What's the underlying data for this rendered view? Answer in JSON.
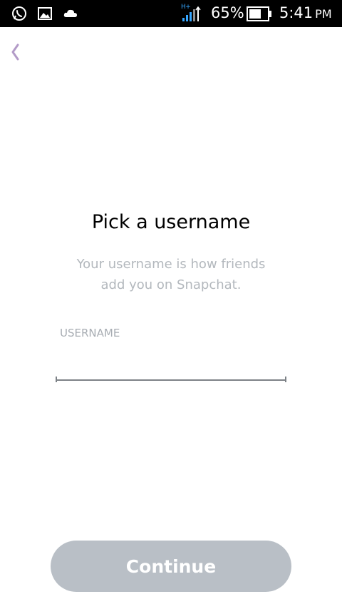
{
  "status_bar": {
    "network_type": "H+",
    "battery_percent": "65%",
    "battery_level": 0.65,
    "time": "5:41",
    "ampm": "PM",
    "icons": [
      "whatsapp-icon",
      "gallery-icon",
      "cloud-icon",
      "signal-icon",
      "battery-icon"
    ]
  },
  "nav": {
    "back_icon": "chevron-left-icon",
    "back_color": "#b39bc8"
  },
  "main": {
    "title": "Pick a username",
    "subtitle_line1": "Your username is how friends",
    "subtitle_line2": "add you on Snapchat.",
    "field_label": "USERNAME",
    "input_value": "",
    "continue_label": "Continue"
  },
  "colors": {
    "button_bg": "#b9bfc6",
    "subtitle": "#b3b8bd"
  }
}
